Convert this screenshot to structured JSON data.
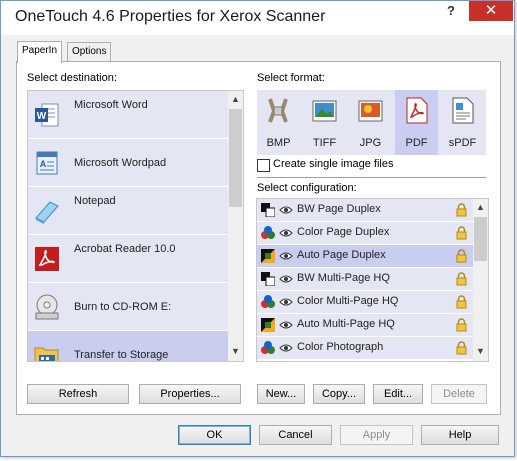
{
  "window": {
    "title": "OneTouch 4.6 Properties for Xerox Scanner",
    "help_glyph": "?",
    "close_glyph": "✕"
  },
  "tabs": [
    {
      "label": "PaperIn",
      "active": true
    },
    {
      "label": "Options",
      "active": false
    }
  ],
  "destination": {
    "label": "Select destination:",
    "items": [
      {
        "label": "Microsoft Word",
        "icon": "word-icon",
        "selected": false
      },
      {
        "label": "Microsoft Wordpad",
        "icon": "wordpad-icon",
        "selected": false
      },
      {
        "label": "Notepad",
        "icon": "notepad-icon",
        "selected": false
      },
      {
        "label": "Acrobat Reader 10.0",
        "icon": "acrobat-icon",
        "selected": false
      },
      {
        "label": "Burn to CD-ROM  E:",
        "icon": "cd-burner-icon",
        "selected": false
      },
      {
        "label": "Transfer to Storage",
        "icon": "storage-folder-icon",
        "selected": true
      }
    ]
  },
  "format": {
    "label": "Select format:",
    "items": [
      {
        "label": "BMP",
        "icon": "bmp-icon",
        "selected": false
      },
      {
        "label": "TIFF",
        "icon": "tiff-icon",
        "selected": false
      },
      {
        "label": "JPG",
        "icon": "jpg-icon",
        "selected": false
      },
      {
        "label": "PDF",
        "icon": "pdf-icon",
        "selected": true
      },
      {
        "label": "sPDF",
        "icon": "spdf-icon",
        "selected": false
      }
    ],
    "single_image_label": "Create single image files",
    "single_image_checked": false
  },
  "configuration": {
    "label": "Select configuration:",
    "items": [
      {
        "label": "BW Page Duplex",
        "icon": "bw-scan-icon",
        "selected": false
      },
      {
        "label": "Color Page Duplex",
        "icon": "color-scan-icon",
        "selected": false
      },
      {
        "label": "Auto Page Duplex",
        "icon": "auto-scan-icon",
        "selected": true
      },
      {
        "label": "BW Multi-Page HQ",
        "icon": "bw-scan-icon",
        "selected": false
      },
      {
        "label": "Color Multi-Page HQ",
        "icon": "color-scan-icon",
        "selected": false
      },
      {
        "label": "Auto Multi-Page HQ",
        "icon": "auto-scan-icon",
        "selected": false
      },
      {
        "label": "Color Photograph",
        "icon": "color-scan-icon",
        "selected": false
      }
    ]
  },
  "buttons": {
    "refresh": "Refresh",
    "properties": "Properties...",
    "new": "New...",
    "copy": "Copy...",
    "edit": "Edit...",
    "delete": "Delete",
    "ok": "OK",
    "cancel": "Cancel",
    "apply": "Apply",
    "help": "Help"
  },
  "colors": {
    "list_background": "#e4e6f3",
    "selection": "#c9cdf0",
    "close_button": "#c7312a"
  }
}
